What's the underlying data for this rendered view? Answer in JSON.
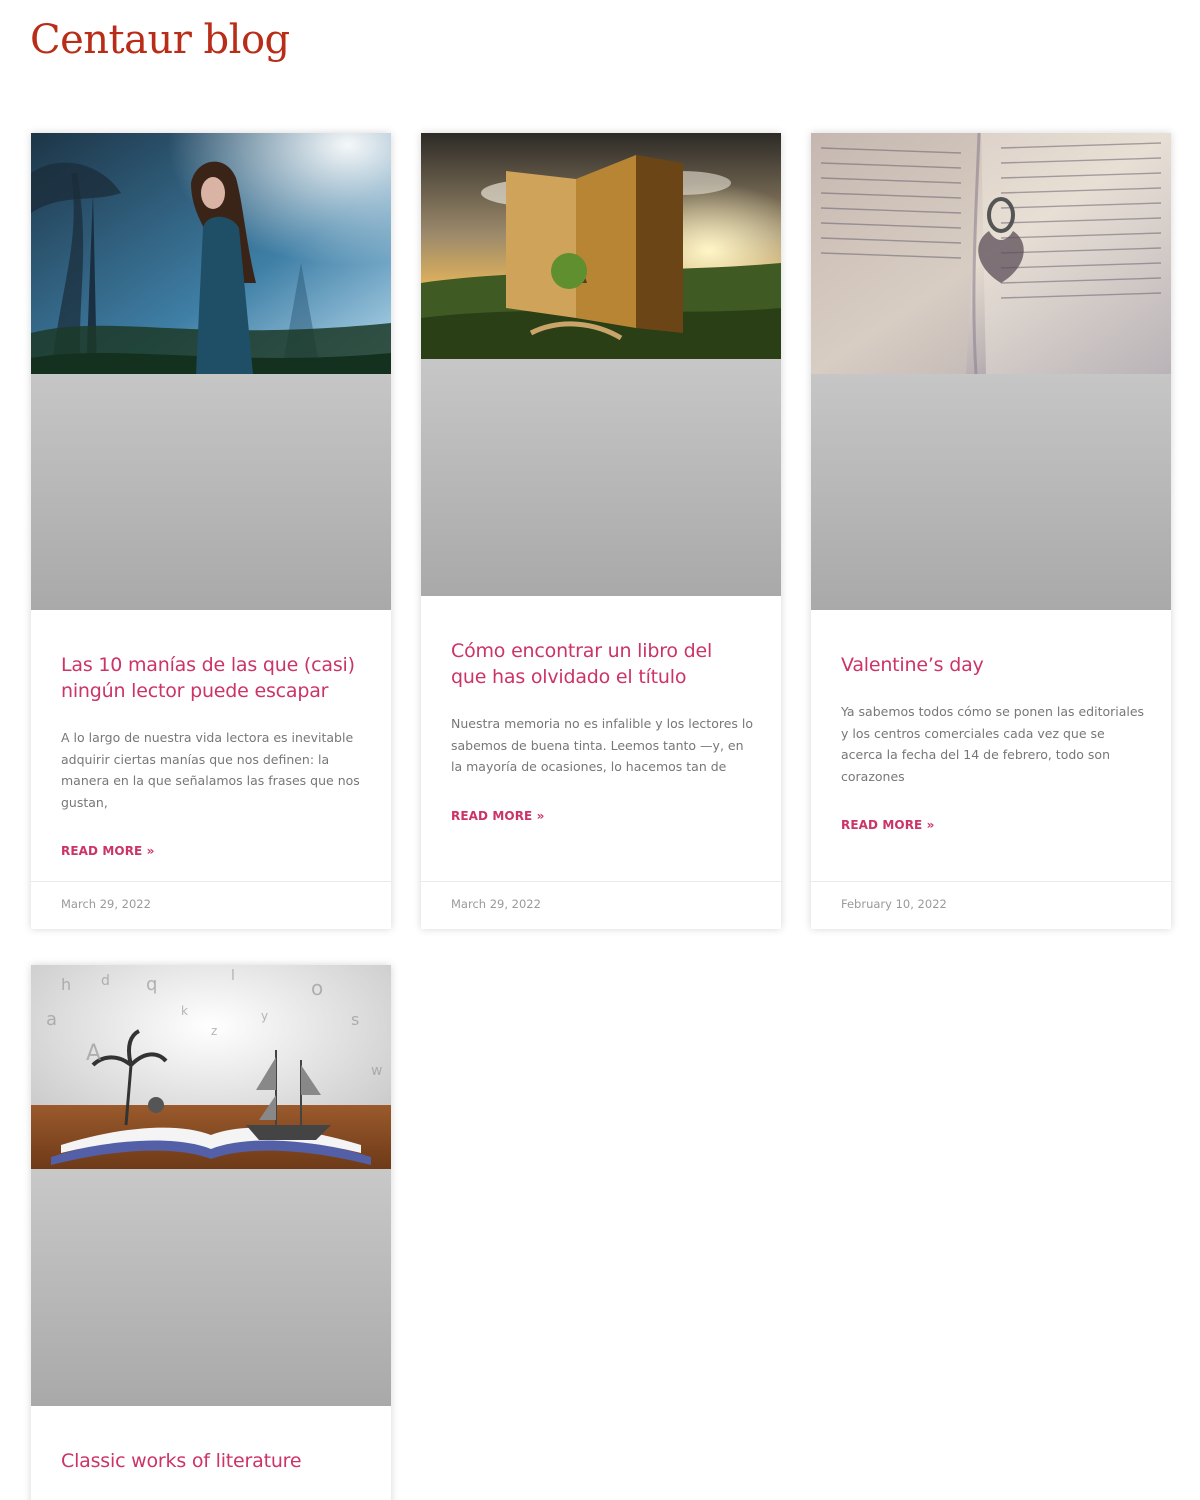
{
  "site": {
    "title": "Centaur blog"
  },
  "posts": [
    {
      "title": "Las 10 manías de las que (casi) ningún lector puede escapar",
      "excerpt": "A lo largo de nuestra vida lectora es inevitable adquirir ciertas manías que nos definen: la manera en la que señalamos las frases que nos gustan,",
      "read_more": "READ MORE »",
      "date": "March 29, 2022",
      "image_icon": "woman-in-misty-forest-image"
    },
    {
      "title": "Cómo encontrar un libro del que has olvidado el título",
      "excerpt": "Nuestra memoria no es infalible y los lectores lo sabemos de buena tinta. Leemos tanto —y, en la mayoría de ocasiones, lo hacemos tan de",
      "read_more": "READ MORE »",
      "date": "March 29, 2022",
      "image_icon": "giant-open-book-landscape-image"
    },
    {
      "title": "Valentine’s day",
      "excerpt": "Ya sabemos todos cómo se ponen las editoriales y los centros comerciales cada vez que se acerca la fecha del 14 de febrero, todo son corazones",
      "read_more": "READ MORE »",
      "date": "February 10, 2022",
      "image_icon": "ring-heart-shadow-book-image"
    },
    {
      "title": "Classic works of literature",
      "image_icon": "pop-up-book-pirate-ship-image"
    }
  ],
  "colors": {
    "site_title": "#b92d18",
    "accent": "#cc3366",
    "excerpt_text": "#777777",
    "date_text": "#9a9a9a"
  }
}
